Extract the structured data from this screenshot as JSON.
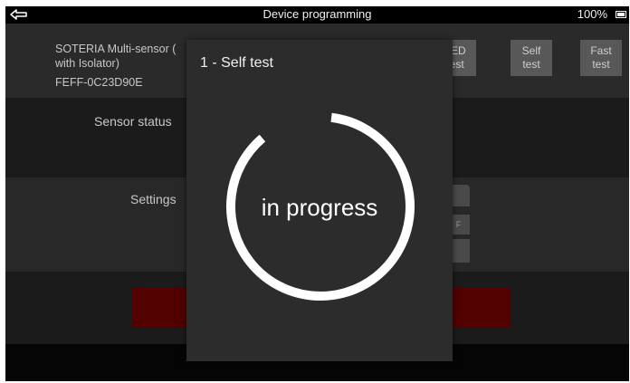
{
  "statusbar": {
    "title": "Device programming",
    "battery_percent": "100%",
    "back_icon": "back-arrow-icon",
    "battery_icon": "battery-icon"
  },
  "device": {
    "name_line1": "SOTERIA Multi-sensor (",
    "name_line2": "with Isolator)",
    "id": "FEFF-0C23D90E"
  },
  "toolbar": {
    "led_line1": "LED",
    "led_line2": "test",
    "self_line1": "Self",
    "self_line2": "test",
    "fast_line1": "Fast",
    "fast_line2": "test"
  },
  "sections": {
    "sensor_status_label": "Sensor status",
    "settings_label": "Settings",
    "settings_toggle_fragment": "F"
  },
  "dialog": {
    "title": "1 - Self test",
    "status": "in progress"
  },
  "colors": {
    "background": "#1e1e1e",
    "dialog": "#2c2c2c",
    "accent_red": "#520000",
    "spinner": "#ffffff"
  }
}
